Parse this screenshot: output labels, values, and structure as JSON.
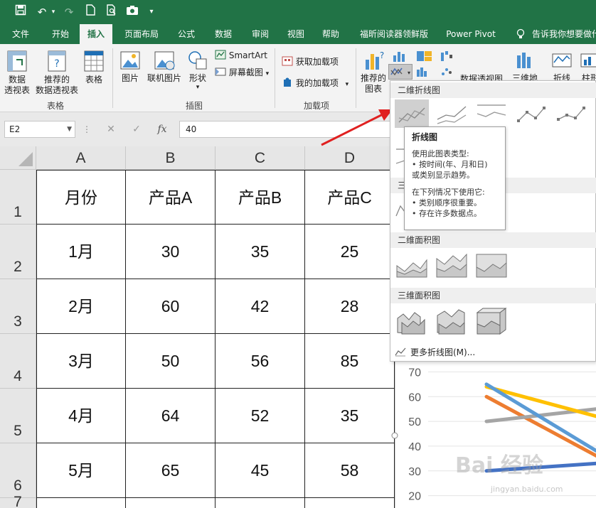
{
  "quick_access": {
    "icons": [
      "save-icon",
      "undo-icon",
      "redo-icon",
      "new-file-icon",
      "print-preview-icon",
      "camera-icon",
      "customize-icon"
    ],
    "undo_glyph": "↶",
    "redo_glyph": "↷"
  },
  "tabs": [
    {
      "label": "文件",
      "active": false
    },
    {
      "label": "开始",
      "active": false
    },
    {
      "label": "插入",
      "active": true
    },
    {
      "label": "页面布局",
      "active": false
    },
    {
      "label": "公式",
      "active": false
    },
    {
      "label": "数据",
      "active": false
    },
    {
      "label": "审阅",
      "active": false
    },
    {
      "label": "视图",
      "active": false
    },
    {
      "label": "帮助",
      "active": false
    },
    {
      "label": "福昕阅读器领鲜版",
      "active": false
    },
    {
      "label": "Power Pivot",
      "active": false
    },
    {
      "label": "告诉我你想要做什",
      "active": false
    }
  ],
  "ribbon": {
    "tables_group": {
      "label": "表格",
      "pivot_table": "数据\n透视表",
      "recommended_pivot": "推荐的\n数据透视表",
      "table": "表格"
    },
    "illustrations_group": {
      "label": "插图",
      "pictures": "图片",
      "online_pictures": "联机图片",
      "shapes": "形状",
      "smartart": "SmartArt",
      "screenshot": "屏幕截图"
    },
    "addins_group": {
      "label": "加载项",
      "get_addins": "获取加载项",
      "my_addins": "我的加载项"
    },
    "charts_group": {
      "recommended_charts": "推荐的\n图表",
      "pivot_chart": "数据透视图",
      "3d_map": "三维地",
      "sparkline_line": "折线",
      "sparkline_column": "柱形"
    }
  },
  "formula_bar": {
    "name_box": "E2",
    "cancel": "✕",
    "enter": "✓",
    "fx": "fx",
    "value": "40"
  },
  "sheet": {
    "columns": [
      "A",
      "B",
      "C",
      "D"
    ],
    "rows": [
      "1",
      "2",
      "3",
      "4",
      "5",
      "6",
      "7"
    ],
    "cells": [
      [
        "月份",
        "产品A",
        "产品B",
        "产品C"
      ],
      [
        "1月",
        "30",
        "35",
        "25"
      ],
      [
        "2月",
        "60",
        "42",
        "28"
      ],
      [
        "3月",
        "50",
        "56",
        "85"
      ],
      [
        "4月",
        "64",
        "52",
        "35"
      ],
      [
        "5月",
        "65",
        "45",
        "58"
      ]
    ]
  },
  "chart_data": {
    "type": "line",
    "ylim": [
      15,
      75
    ],
    "yticks": [
      "70",
      "60",
      "50",
      "40",
      "30",
      "20"
    ],
    "series": [
      {
        "color": "#4472c4",
        "values": [
          30,
          33
        ]
      },
      {
        "color": "#ed7d31",
        "values": [
          60,
          36
        ]
      },
      {
        "color": "#a5a5a5",
        "values": [
          50,
          55
        ]
      },
      {
        "color": "#ffc000",
        "values": [
          64,
          52
        ]
      },
      {
        "color": "#5b9bd5",
        "values": [
          65,
          38
        ]
      }
    ]
  },
  "dropdown": {
    "section_2d_line": "二维折线图",
    "section_3d_line": "三",
    "section_2d_area": "二维面积图",
    "section_3d_area": "三维面积图",
    "more_link": "更多折线图(M)..."
  },
  "tooltip": {
    "title": "折线图",
    "line1": "使用此图表类型:",
    "line2": "• 按时间(年、月和日)",
    "line3": "或类别显示趋势。",
    "line4": "在下列情况下使用它:",
    "line5": "• 类别顺序很重要。",
    "line6": "• 存在许多数据点。"
  },
  "watermark": {
    "main": "Bai 经验",
    "sub": "jingyan.baidu.com"
  },
  "colors": {
    "excel_green": "#217346",
    "arrow_red": "#e02020"
  }
}
